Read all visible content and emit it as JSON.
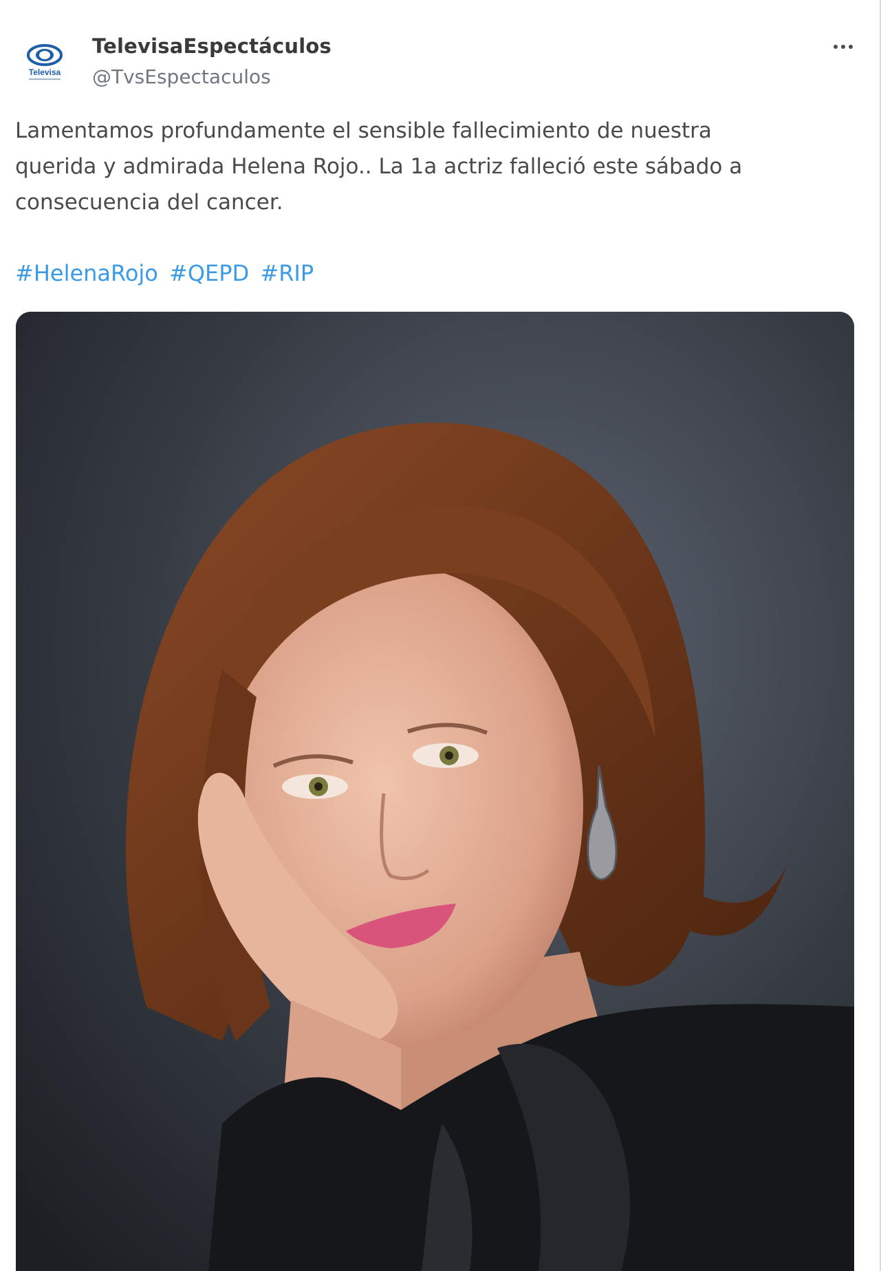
{
  "author": {
    "display_name": "TelevisaEspectáculos",
    "handle": "@TvsEspectaculos",
    "avatar_icon": "televisa-logo-icon",
    "avatar_text": "Televisa",
    "avatar_color": "#1d5fa8"
  },
  "menu": {
    "icon": "more-options-icon"
  },
  "tweet": {
    "text": "Lamentamos profundamente el sensible fallecimiento de nuestra\nquerida y admirada Helena Rojo.. La 1a actriz falleció este sábado a\nconsecuencia del cancer.",
    "hashtags": [
      "#HelenaRojo",
      "#QEPD",
      "#RIP"
    ],
    "hashtag_color": "#3a9ae6"
  },
  "media": {
    "type": "photo"
  }
}
